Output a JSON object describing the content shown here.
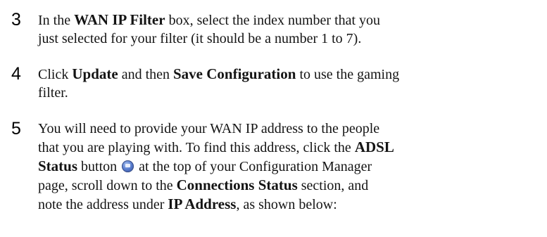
{
  "steps": [
    {
      "number": "3",
      "t1": "In the ",
      "b1": "WAN IP Filter",
      "t2": " box, select the index number that you",
      "l2": "just selected for your filter (it should be a number 1 to 7)."
    },
    {
      "number": "4",
      "t1": "Click ",
      "b1": "Update",
      "t2": " and then ",
      "b2": "Save Configuration",
      "t3": " to use the gaming",
      "l2": "filter."
    },
    {
      "number": "5",
      "l1": "You will need to provide your WAN IP address to the people",
      "l2a": "that you are playing with. To find this address, click the ",
      "l2b": "ADSL",
      "l3b": "Status",
      "l3t": " button ",
      "icon": "adsl-status-icon",
      "l3t2": " at the top of your Configuration Manager",
      "l4a": "page, scroll down to the ",
      "l4b": "Connections Status",
      "l4t": " section, and",
      "l5a": "note the address under ",
      "l5b": "IP Address",
      "l5t": ", as shown below:"
    }
  ]
}
